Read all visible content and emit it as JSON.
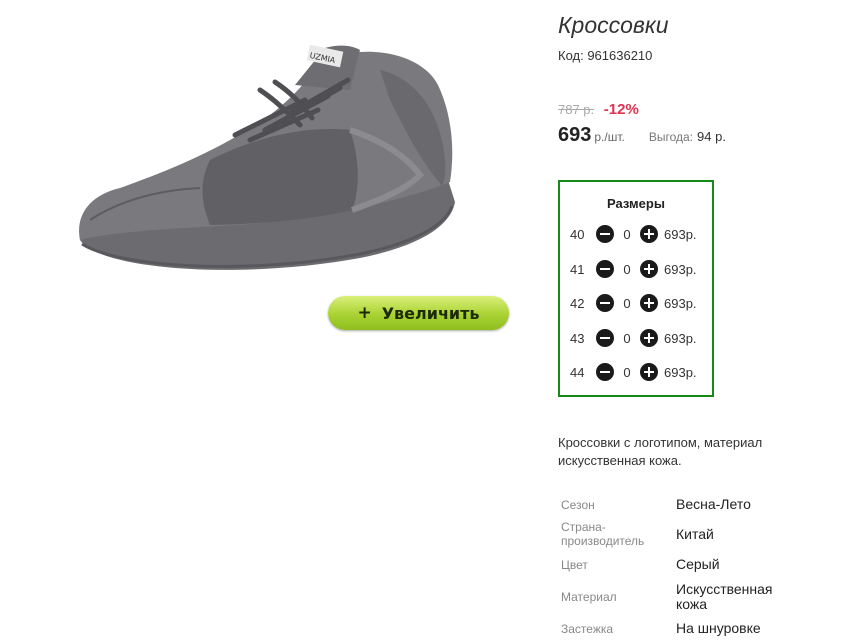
{
  "product": {
    "title": "Кроссовки",
    "sku": "Код: 961636210",
    "old_price": "787 р.",
    "discount": "-12%",
    "price": "693",
    "price_unit": "р./шт.",
    "benefit_label": "Выгода:",
    "benefit_value": "94 р.",
    "shoe_brand_text": "UZMIA",
    "zoom_button": {
      "label": "Увеличить",
      "icon": "plus-icon"
    }
  },
  "sizes": {
    "title": "Размеры",
    "rows": [
      {
        "size": "40",
        "qty": "0",
        "price": "693р."
      },
      {
        "size": "41",
        "qty": "0",
        "price": "693р."
      },
      {
        "size": "42",
        "qty": "0",
        "price": "693р."
      },
      {
        "size": "43",
        "qty": "0",
        "price": "693р."
      },
      {
        "size": "44",
        "qty": "0",
        "price": "693р."
      }
    ]
  },
  "description": "Кроссовки с логотипом, материал искусственная кожа.",
  "attributes": [
    {
      "label": "Сезон",
      "value": "Весна-Лето"
    },
    {
      "label": "Страна-производитель",
      "value": "Китай"
    },
    {
      "label": "Цвет",
      "value": "Серый"
    },
    {
      "label": "Материал",
      "value": "Искусственная кожа"
    },
    {
      "label": "Застежка",
      "value": "На шнуровке"
    }
  ],
  "colors": {
    "frame": "#168a16",
    "discount": "#e0334f",
    "button": "#a9d233"
  }
}
